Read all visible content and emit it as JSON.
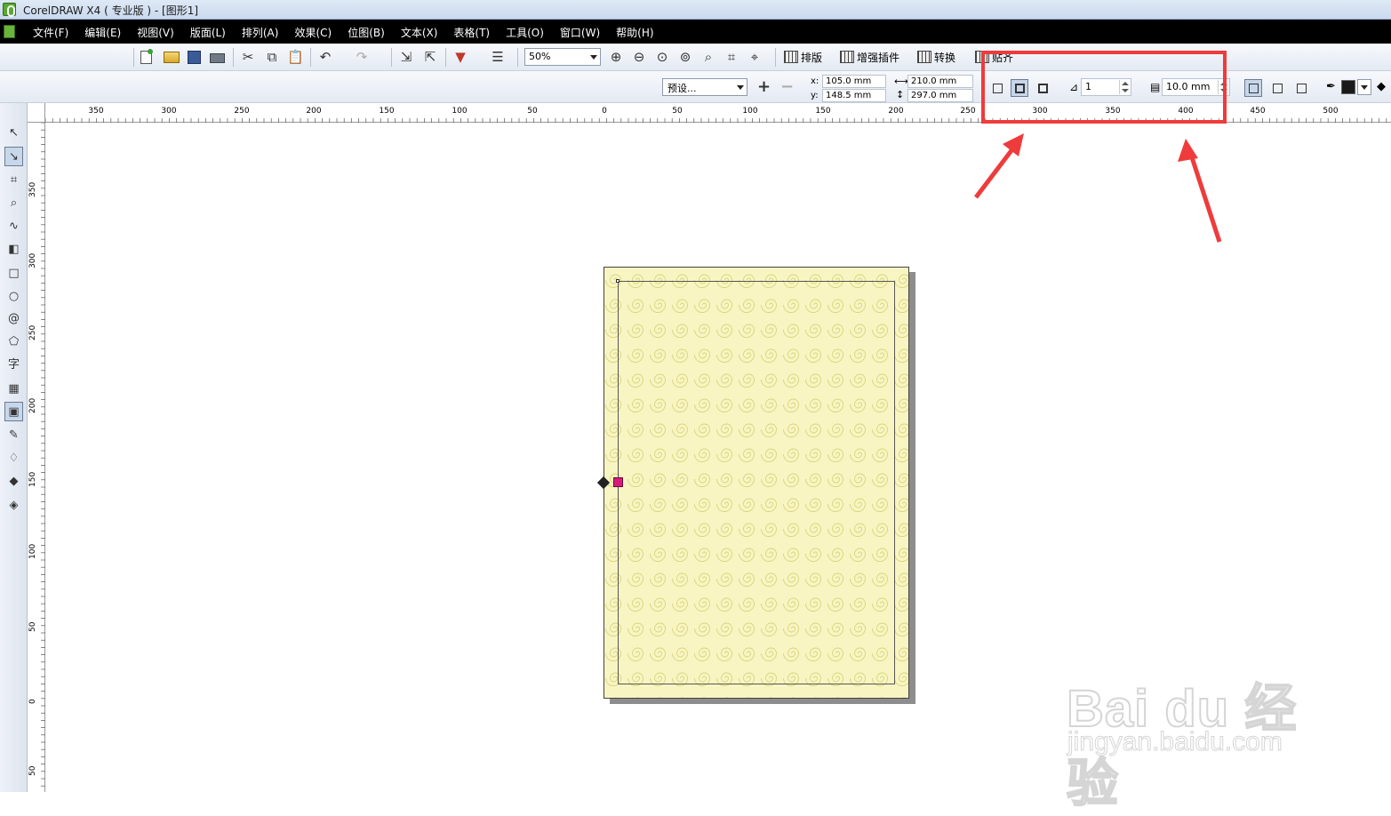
{
  "window": {
    "title": "CorelDRAW X4 ( 专业版 ) - [图形1]"
  },
  "menu": [
    "文件(F)",
    "编辑(E)",
    "视图(V)",
    "版面(L)",
    "排列(A)",
    "效果(C)",
    "位图(B)",
    "文本(X)",
    "表格(T)",
    "工具(O)",
    "窗口(W)",
    "帮助(H)"
  ],
  "toolbar": {
    "zoom_value": "50%",
    "plugins": [
      "排版",
      "增强插件",
      "转换",
      "贴齐"
    ]
  },
  "property_bar": {
    "preset": "预设...",
    "x_label": "x:",
    "x_value": "105.0 mm",
    "y_label": "y:",
    "y_value": "148.5 mm",
    "width_value": "210.0 mm",
    "height_value": "297.0 mm",
    "steps_value": "1",
    "offset_value": "10.0 mm",
    "outline_color": "#1a1a1a"
  },
  "rulers": {
    "horizontal": [
      "350",
      "300",
      "250",
      "200",
      "150",
      "100",
      "50",
      "0",
      "50",
      "100",
      "150",
      "200",
      "250",
      "300",
      "350",
      "400",
      "450",
      "500"
    ],
    "vertical": [
      "350",
      "300",
      "250",
      "200",
      "150",
      "100",
      "50",
      "0",
      "50"
    ]
  },
  "tools": [
    "pick-tool",
    "shape-tool",
    "crop-tool",
    "zoom-tool",
    "freehand-tool",
    "smart-fill-tool",
    "rectangle-tool",
    "ellipse-tool",
    "spiral-tool",
    "basic-shapes-tool",
    "text-tool",
    "table-tool",
    "contour-tool",
    "eyedropper-tool",
    "outline-tool",
    "fill-tool",
    "interactive-fill-tool"
  ],
  "tool_glyphs": [
    "↖",
    "↘",
    "⌗",
    "⌕",
    "∿",
    "◧",
    "□",
    "○",
    "@",
    "⬠",
    "字",
    "▦",
    "▣",
    "✎",
    "♢",
    "◆",
    "◈"
  ],
  "page": {
    "background": "#f8f5c3",
    "pattern_color": "#d8d47a"
  },
  "annotation": {
    "color": "#ef3b3b"
  },
  "watermark": {
    "text": "Bai du 经验",
    "url": "jingyan.baidu.com"
  }
}
